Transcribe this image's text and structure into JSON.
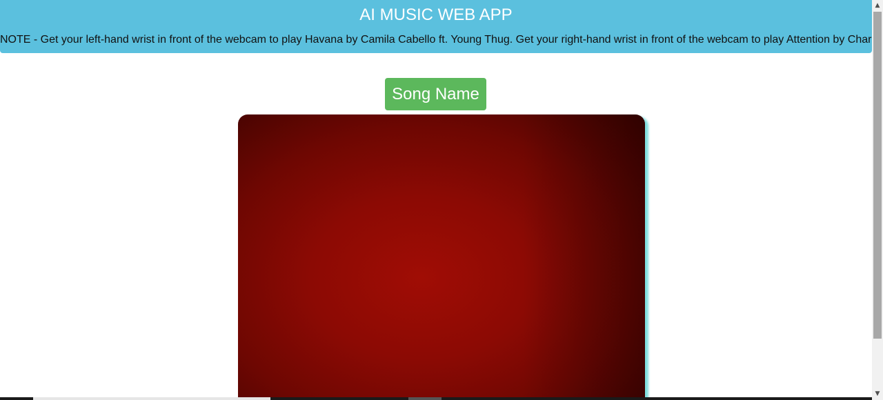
{
  "header": {
    "title": "AI MUSIC WEB APP",
    "note": "NOTE - Get your left-hand wrist in front of the webcam to play Havana by Camila Cabello ft. Young Thug. Get your right-hand wrist in front of the webcam to play Attention by Charlie Puth",
    "background_color": "#5bc0de"
  },
  "song_button": {
    "label": "Song Name",
    "color": "#5cb85c"
  },
  "webcam": {
    "border_glow_color": "#7fdedf"
  },
  "scrollbar": {
    "up_icon": "chevron-up-icon",
    "down_icon": "chevron-down-icon"
  }
}
